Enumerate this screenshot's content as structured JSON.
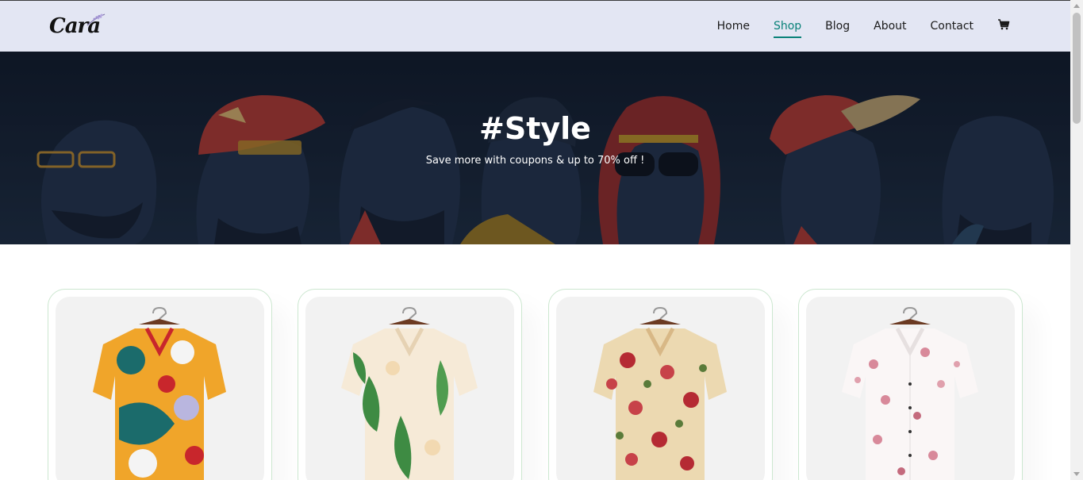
{
  "brand": {
    "logo_text": "Cara"
  },
  "nav": {
    "items": [
      {
        "label": "Home",
        "active": false
      },
      {
        "label": "Shop",
        "active": true
      },
      {
        "label": "Blog",
        "active": false
      },
      {
        "label": "About",
        "active": false
      },
      {
        "label": "Contact",
        "active": false
      }
    ],
    "cart_icon": "cart-icon"
  },
  "hero": {
    "title": "#Style",
    "subtitle": "Save more with coupons & up to 70% off !"
  },
  "products": [
    {
      "image": "floral-shirt-multicolor"
    },
    {
      "image": "floral-shirt-green-leaves"
    },
    {
      "image": "floral-shirt-beige-roses"
    },
    {
      "image": "floral-shirt-white-pink"
    }
  ],
  "colors": {
    "accent": "#088178",
    "header_bg": "#e3e6f3",
    "hero_bg": "#1a2537",
    "card_border": "#cce7d0"
  }
}
